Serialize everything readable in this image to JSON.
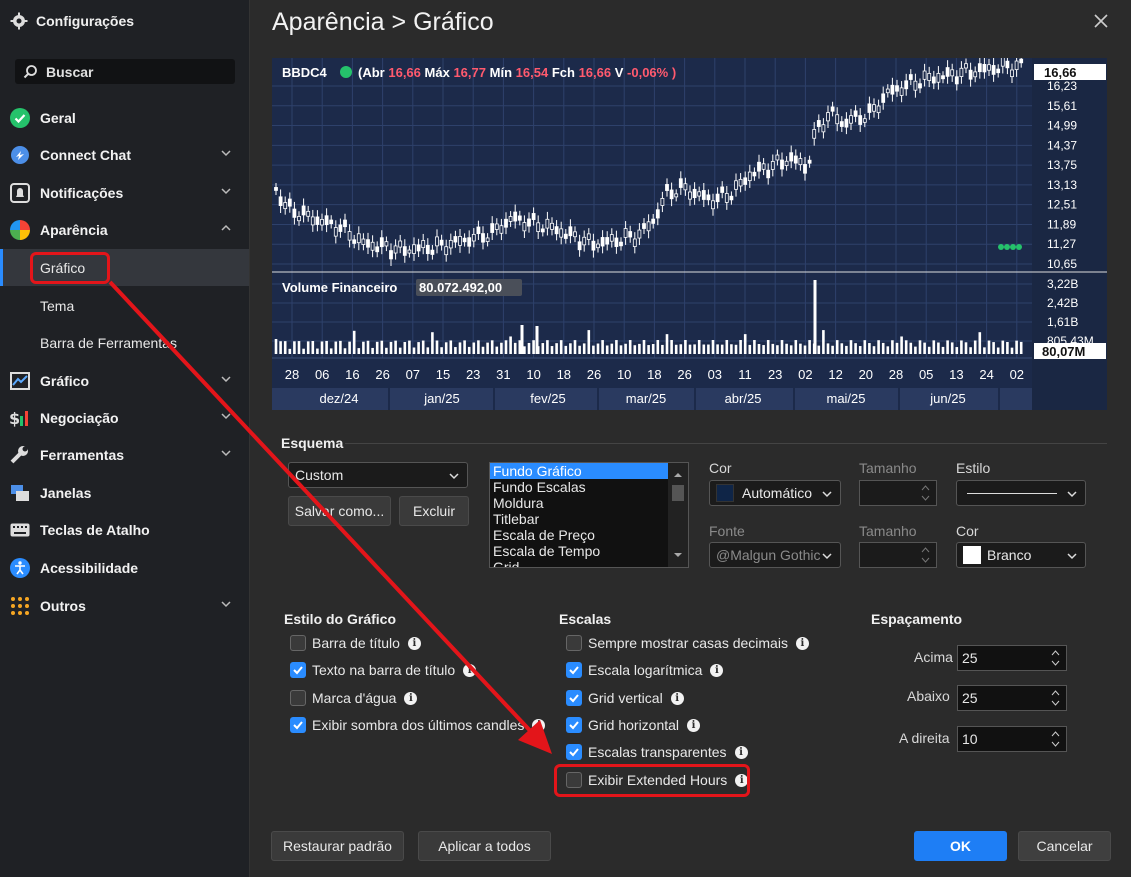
{
  "sidebar": {
    "title": "Configurações",
    "search_label": "Buscar",
    "items": [
      {
        "label": "Geral"
      },
      {
        "label": "Connect Chat"
      },
      {
        "label": "Notificações"
      },
      {
        "label": "Aparência"
      },
      {
        "label": "Gráfico"
      },
      {
        "label": "Negociação"
      },
      {
        "label": "Ferramentas"
      },
      {
        "label": "Janelas"
      },
      {
        "label": "Teclas de Atalho"
      },
      {
        "label": "Acessibilidade"
      },
      {
        "label": "Outros"
      }
    ],
    "sub_items": [
      "Gráfico",
      "Tema",
      "Barra de Ferramentas"
    ]
  },
  "header": {
    "title": "Aparência > Gráfico"
  },
  "chart_preview": {
    "ticker": "BBDC4",
    "ohlc": {
      "abr_label": "Abr",
      "abr": "16,66",
      "max_label": "Máx",
      "max": "16,77",
      "min_label": "Mín",
      "min": "16,54",
      "fch_label": "Fch",
      "fch": "16,66",
      "v_label": "V",
      "v": "-0,06%"
    },
    "price_ticks": [
      "16,23",
      "15,61",
      "14,99",
      "14,37",
      "13,75",
      "13,13",
      "12,51",
      "11,89",
      "11,27",
      "10,65"
    ],
    "last_price": "16,66",
    "volume_title": "Volume Financeiro",
    "volume_value": "80.072.492,00",
    "volume_ticks": [
      "3,22B",
      "2,42B",
      "1,61B",
      "805,43M"
    ],
    "last_volume": "80,07M",
    "day_ticks": [
      "28",
      "06",
      "16",
      "26",
      "07",
      "15",
      "23",
      "31",
      "10",
      "18",
      "26",
      "10",
      "18",
      "26",
      "03",
      "11",
      "23",
      "02",
      "12",
      "20",
      "28",
      "05",
      "13",
      "24",
      "02"
    ],
    "month_ticks": [
      "dez/24",
      "jan/25",
      "fev/25",
      "mar/25",
      "abr/25",
      "mai/25",
      "jun/25"
    ]
  },
  "esquema": {
    "title": "Esquema",
    "scheme_value": "Custom",
    "save_as_label": "Salvar como...",
    "delete_label": "Excluir",
    "elements": [
      "Fundo Gráfico",
      "Fundo Escalas",
      "Moldura",
      "Titlebar",
      "Escala de Preço",
      "Escala de Tempo",
      "Grid"
    ],
    "cor_label": "Cor",
    "cor_value": "Automático",
    "tamanho_label": "Tamanho",
    "estilo_label": "Estilo",
    "fonte_label": "Fonte",
    "fonte_value": "@Malgun Gothic",
    "tamanho2_label": "Tamanho",
    "cor2_label": "Cor",
    "cor2_value": "Branco"
  },
  "estilo_grafico": {
    "title": "Estilo do Gráfico",
    "options": [
      {
        "label": "Barra de título",
        "checked": false
      },
      {
        "label": "Texto na barra de título",
        "checked": true
      },
      {
        "label": "Marca d'água",
        "checked": false
      },
      {
        "label": "Exibir sombra dos últimos candles",
        "checked": true
      }
    ]
  },
  "escalas": {
    "title": "Escalas",
    "options": [
      {
        "label": "Sempre mostrar casas decimais",
        "checked": false
      },
      {
        "label": "Escala logarítmica",
        "checked": true
      },
      {
        "label": "Grid vertical",
        "checked": true
      },
      {
        "label": "Grid horizontal",
        "checked": true
      },
      {
        "label": "Escalas transparentes",
        "checked": true
      },
      {
        "label": "Exibir Extended Hours",
        "checked": false
      }
    ]
  },
  "espacamento": {
    "title": "Espaçamento",
    "acima_label": "Acima",
    "acima_value": "25",
    "abaixo_label": "Abaixo",
    "abaixo_value": "25",
    "direita_label": "A direita",
    "direita_value": "10"
  },
  "footer": {
    "restore_label": "Restaurar padrão",
    "apply_all_label": "Aplicar a todos",
    "ok_label": "OK",
    "cancel_label": "Cancelar"
  },
  "colors": {
    "accent": "#2a8cff",
    "highlight": "#e3151a",
    "chart_bg": "#1c2a4a",
    "red_text": "#ff5a6e"
  }
}
